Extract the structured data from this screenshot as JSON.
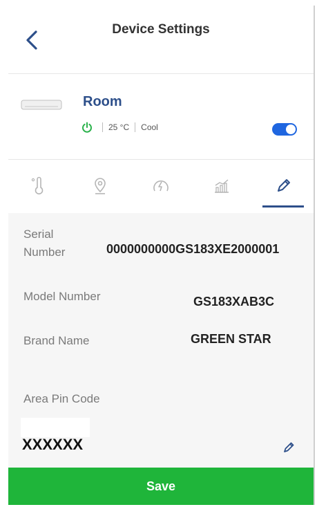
{
  "header": {
    "title": "Device Settings",
    "back_icon": "chevron-left-icon"
  },
  "device": {
    "name": "Room",
    "temperature": "25 °C",
    "mode": "Cool",
    "power_on": true,
    "toggle_on": true
  },
  "tabs": [
    {
      "icon": "thermometer-icon",
      "active": false
    },
    {
      "icon": "location-pin-icon",
      "active": false
    },
    {
      "icon": "gauge-icon",
      "active": false
    },
    {
      "icon": "chart-icon",
      "active": false
    },
    {
      "icon": "pencil-icon",
      "active": true
    }
  ],
  "details": {
    "serial_label_line1": "Serial",
    "serial_label_line2": "Number",
    "serial_value": "0000000000GS183XE2000001",
    "model_label": "Model Number",
    "model_value": "GS183XAB3C",
    "brand_label": "Brand Name",
    "brand_value": "GREEN STAR",
    "pin_label": "Area Pin Code",
    "pin_value": "XXXXXX"
  },
  "save_label": "Save",
  "colors": {
    "accent": "#2d4f8a",
    "toggle": "#1f66e0",
    "save": "#1fb53a",
    "power": "#2bb24c"
  }
}
